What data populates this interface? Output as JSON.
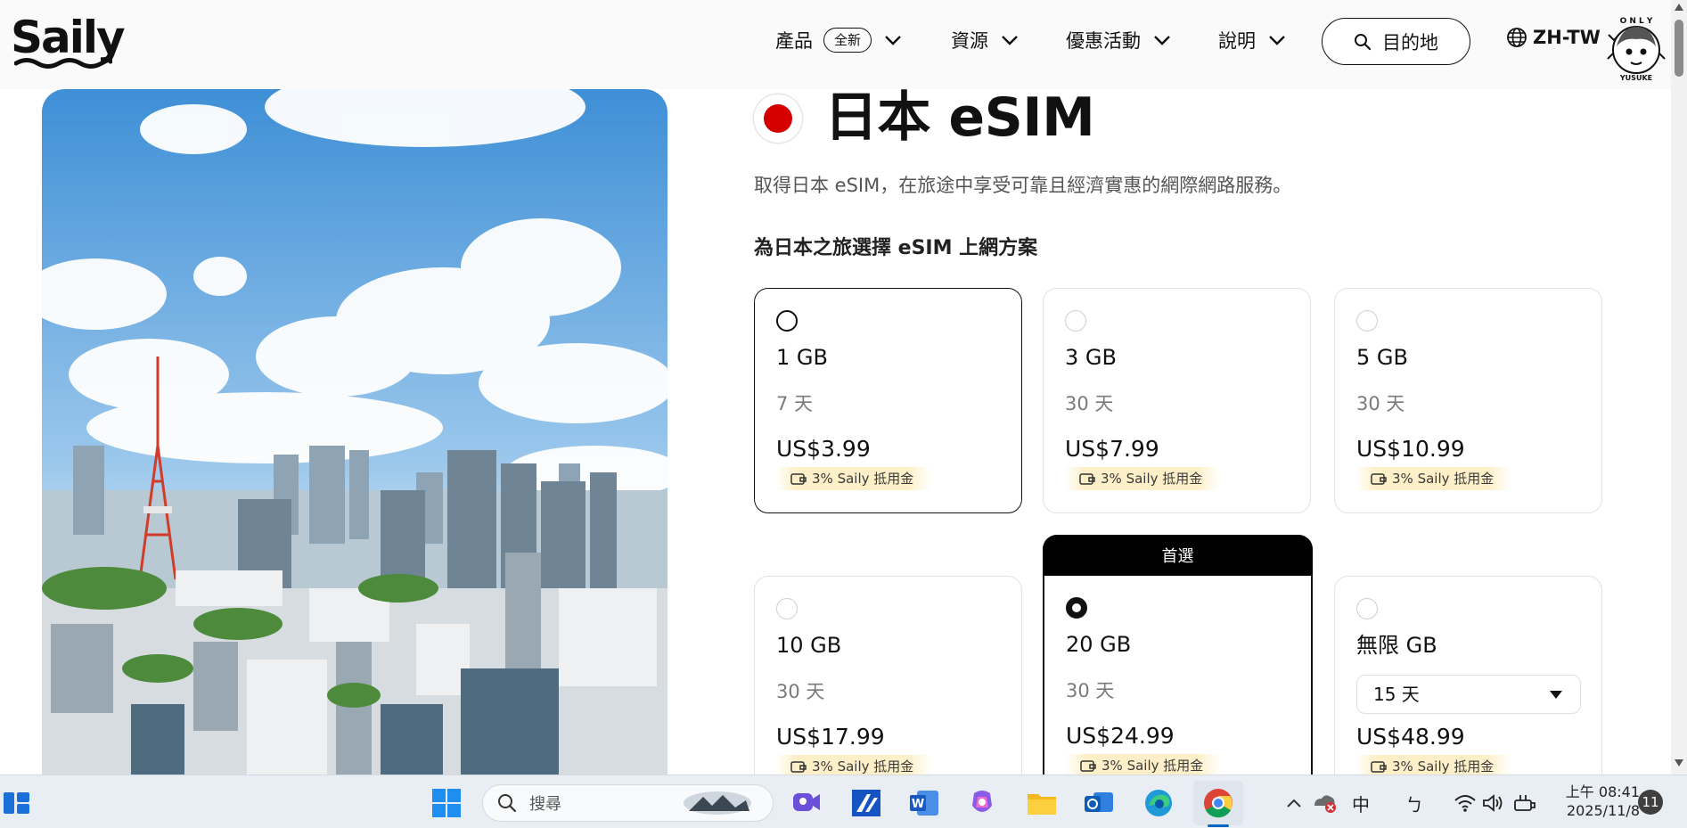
{
  "header": {
    "logo_text": "Saily",
    "nav": [
      {
        "label": "產品",
        "badge": "全新"
      },
      {
        "label": "資源"
      },
      {
        "label": "優惠活動"
      },
      {
        "label": "說明"
      }
    ],
    "destination_button": "目的地",
    "language": "ZH-TW",
    "avatar_text": "ONLY YUSUKE"
  },
  "page": {
    "title": "日本 eSIM",
    "subtitle": "取得日本 eSIM，在旅途中享受可靠且經濟實惠的網際網路服務。",
    "plan_heading": "為日本之旅選擇 eSIM 上網方案",
    "featured_label": "首選"
  },
  "plans": [
    {
      "data": "1 GB",
      "days": "7 天",
      "price": "US$3.99",
      "credit": "3% Saily 抵用金",
      "state": "hovered"
    },
    {
      "data": "3 GB",
      "days": "30 天",
      "price": "US$7.99",
      "credit": "3% Saily 抵用金",
      "state": "normal"
    },
    {
      "data": "5 GB",
      "days": "30 天",
      "price": "US$10.99",
      "credit": "3% Saily 抵用金",
      "state": "normal"
    },
    {
      "data": "10 GB",
      "days": "30 天",
      "price": "US$17.99",
      "credit": "3% Saily 抵用金",
      "state": "normal"
    },
    {
      "data": "20 GB",
      "days": "30 天",
      "price": "US$24.99",
      "credit": "3% Saily 抵用金",
      "state": "selected"
    },
    {
      "data": "無限 GB",
      "days_select": "15 天",
      "price": "US$48.99",
      "credit": "3% Saily 抵用金",
      "state": "normal"
    }
  ],
  "taskbar": {
    "search_placeholder": "搜尋",
    "ime": "中",
    "ime_mode": "ㄅ",
    "time": "上午 08:41",
    "date": "2025/11/8",
    "notifications": "11"
  },
  "colors": {
    "accent": "#000000",
    "flag_red": "#d40000",
    "credit_bg": "#fdf0c8",
    "muted_text": "#7a7a7a"
  }
}
